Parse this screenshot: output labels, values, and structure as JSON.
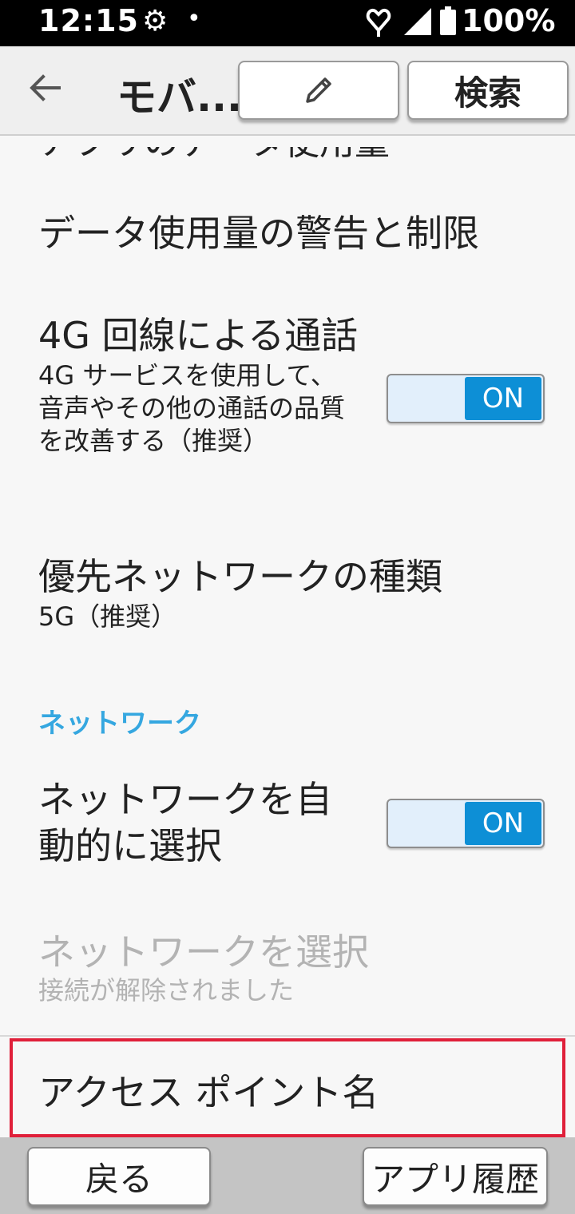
{
  "status_bar": {
    "time": "12:15",
    "gear_icon": "gear-icon",
    "dot": "•",
    "battery_percent": "100%"
  },
  "app_bar": {
    "title": "モバ...",
    "edit_icon": "pencil-icon",
    "search_label": "検索"
  },
  "list": {
    "cut_off_item": "アプリのデータ使用量",
    "data_warning": {
      "title": "データ使用量の警告と制限"
    },
    "volte": {
      "title": "4G 回線による通話",
      "subtitle": "4G サービスを使用して、音声やその他の通話の品質を改善する（推奨）",
      "toggle_label": "ON"
    },
    "preferred_network": {
      "title": "優先ネットワークの種類",
      "subtitle": "5G（推奨）"
    },
    "section_network": "ネットワーク",
    "auto_select": {
      "title": "ネットワークを自動的に選択",
      "toggle_label": "ON"
    },
    "select_network": {
      "title": "ネットワークを選択",
      "subtitle": "接続が解除されました"
    },
    "apn": {
      "title": "アクセス ポイント名"
    }
  },
  "nav_bar": {
    "back_label": "戻る",
    "history_label": "アプリ履歴"
  },
  "colors": {
    "accent": "#35a7e0",
    "toggle_on": "#0d8fd6",
    "highlight": "#e0203a"
  }
}
